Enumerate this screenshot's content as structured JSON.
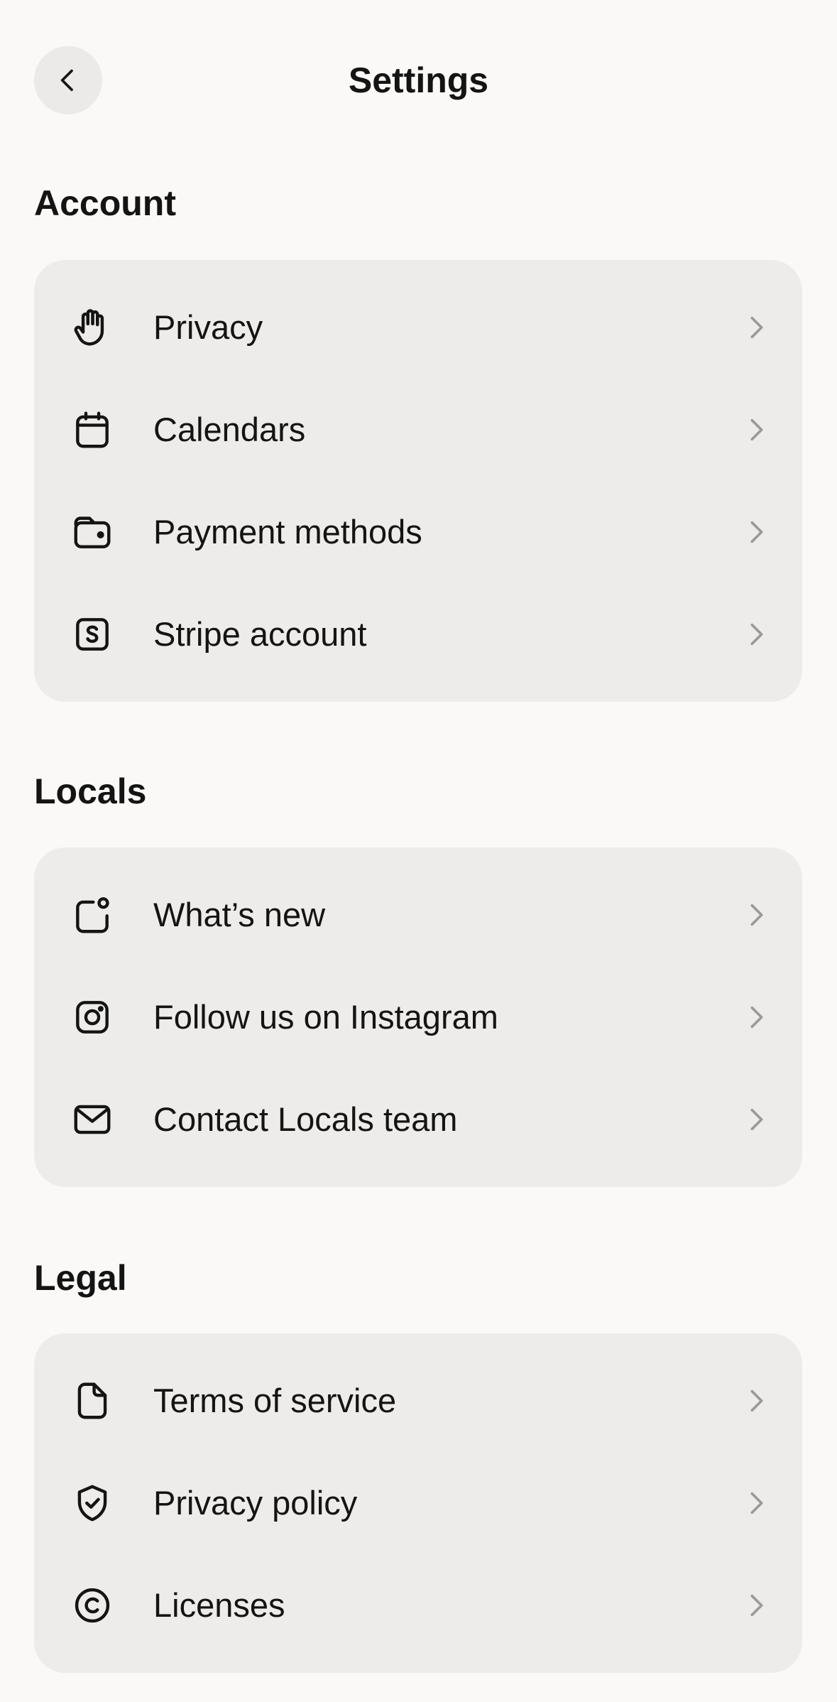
{
  "header": {
    "title": "Settings"
  },
  "sections": [
    {
      "title": "Account",
      "items": [
        {
          "label": "Privacy",
          "icon": "hand-icon"
        },
        {
          "label": "Calendars",
          "icon": "calendar-icon"
        },
        {
          "label": "Payment methods",
          "icon": "wallet-icon"
        },
        {
          "label": "Stripe account",
          "icon": "stripe-icon"
        }
      ]
    },
    {
      "title": "Locals",
      "items": [
        {
          "label": "What’s new",
          "icon": "notification-icon"
        },
        {
          "label": "Follow us on Instagram",
          "icon": "instagram-icon"
        },
        {
          "label": "Contact Locals team",
          "icon": "mail-icon"
        }
      ]
    },
    {
      "title": "Legal",
      "items": [
        {
          "label": "Terms of service",
          "icon": "document-icon"
        },
        {
          "label": "Privacy policy",
          "icon": "shield-check-icon"
        },
        {
          "label": "Licenses",
          "icon": "copyright-icon"
        }
      ]
    }
  ],
  "colors": {
    "background": "#faf9f7",
    "card": "#edecea",
    "back_button": "#ebeae8",
    "text": "#141414",
    "chevron": "#9a9a9a"
  }
}
